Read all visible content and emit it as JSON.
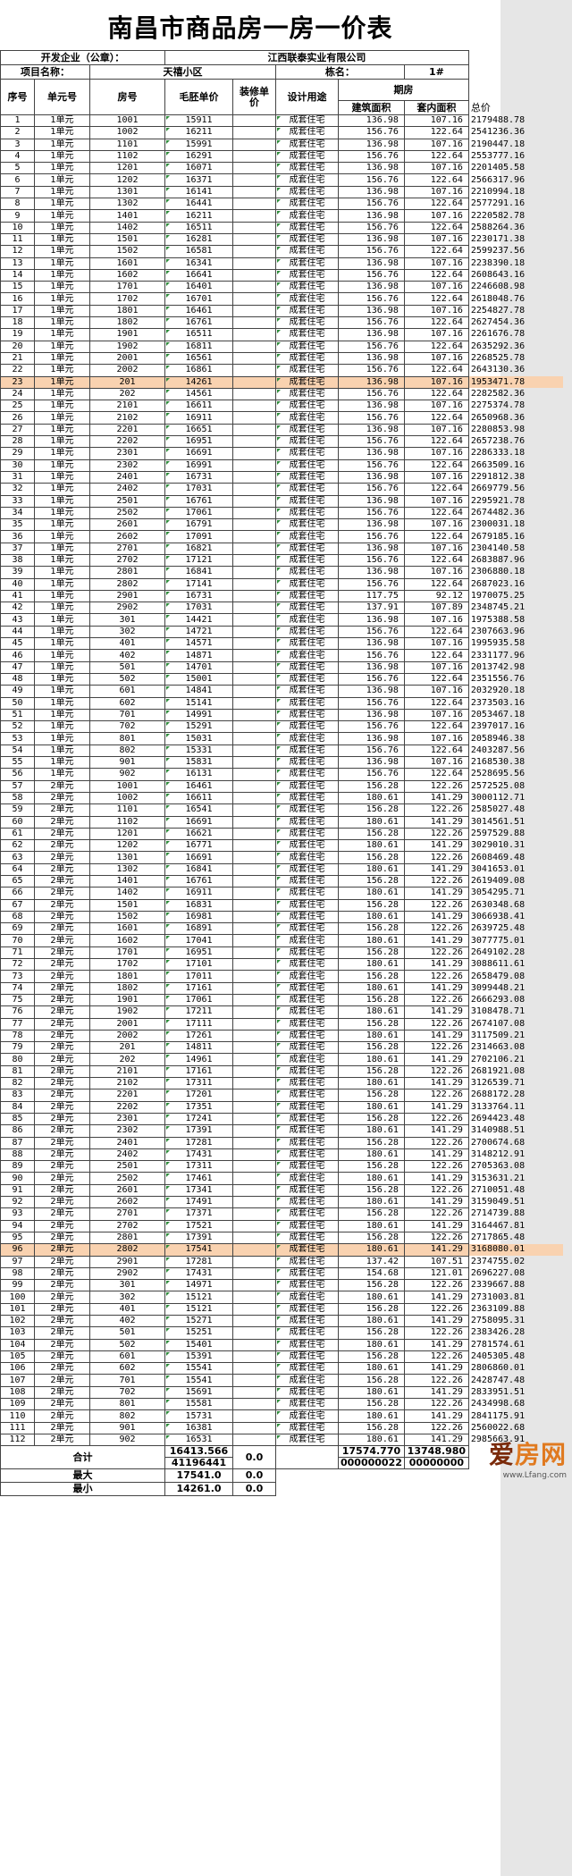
{
  "title": "南昌市商品房一房一价表",
  "developer_label": "开发企业（公章）：",
  "developer_name": "江西联泰实业有限公司",
  "project_label": "项目名称：",
  "project_name": "天禧小区",
  "building_label": "栋名：",
  "building_name": "1#",
  "headers": {
    "seq": "序号",
    "unit": "单元号",
    "room": "房号",
    "price": "毛胚单价",
    "deco": "装修单价",
    "use": "设计用途",
    "group": "期房",
    "build_area": "建筑面积",
    "inner_area": "套内面积",
    "total": "总价"
  },
  "rows": [
    [
      "1",
      "1单元",
      "1001",
      "15911",
      "",
      "成套住宅",
      "136.98",
      "107.16",
      "2179488.78"
    ],
    [
      "2",
      "1单元",
      "1002",
      "16211",
      "",
      "成套住宅",
      "156.76",
      "122.64",
      "2541236.36"
    ],
    [
      "3",
      "1单元",
      "1101",
      "15991",
      "",
      "成套住宅",
      "136.98",
      "107.16",
      "2190447.18"
    ],
    [
      "4",
      "1单元",
      "1102",
      "16291",
      "",
      "成套住宅",
      "156.76",
      "122.64",
      "2553777.16"
    ],
    [
      "5",
      "1单元",
      "1201",
      "16071",
      "",
      "成套住宅",
      "136.98",
      "107.16",
      "2201405.58"
    ],
    [
      "6",
      "1单元",
      "1202",
      "16371",
      "",
      "成套住宅",
      "156.76",
      "122.64",
      "2566317.96"
    ],
    [
      "7",
      "1单元",
      "1301",
      "16141",
      "",
      "成套住宅",
      "136.98",
      "107.16",
      "2210994.18"
    ],
    [
      "8",
      "1单元",
      "1302",
      "16441",
      "",
      "成套住宅",
      "156.76",
      "122.64",
      "2577291.16"
    ],
    [
      "9",
      "1单元",
      "1401",
      "16211",
      "",
      "成套住宅",
      "136.98",
      "107.16",
      "2220582.78"
    ],
    [
      "10",
      "1单元",
      "1402",
      "16511",
      "",
      "成套住宅",
      "156.76",
      "122.64",
      "2588264.36"
    ],
    [
      "11",
      "1单元",
      "1501",
      "16281",
      "",
      "成套住宅",
      "136.98",
      "107.16",
      "2230171.38"
    ],
    [
      "12",
      "1单元",
      "1502",
      "16581",
      "",
      "成套住宅",
      "156.76",
      "122.64",
      "2599237.56"
    ],
    [
      "13",
      "1单元",
      "1601",
      "16341",
      "",
      "成套住宅",
      "136.98",
      "107.16",
      "2238390.18"
    ],
    [
      "14",
      "1单元",
      "1602",
      "16641",
      "",
      "成套住宅",
      "156.76",
      "122.64",
      "2608643.16"
    ],
    [
      "15",
      "1单元",
      "1701",
      "16401",
      "",
      "成套住宅",
      "136.98",
      "107.16",
      "2246608.98"
    ],
    [
      "16",
      "1单元",
      "1702",
      "16701",
      "",
      "成套住宅",
      "156.76",
      "122.64",
      "2618048.76"
    ],
    [
      "17",
      "1单元",
      "1801",
      "16461",
      "",
      "成套住宅",
      "136.98",
      "107.16",
      "2254827.78"
    ],
    [
      "18",
      "1单元",
      "1802",
      "16761",
      "",
      "成套住宅",
      "156.76",
      "122.64",
      "2627454.36"
    ],
    [
      "19",
      "1单元",
      "1901",
      "16511",
      "",
      "成套住宅",
      "136.98",
      "107.16",
      "2261676.78"
    ],
    [
      "20",
      "1单元",
      "1902",
      "16811",
      "",
      "成套住宅",
      "156.76",
      "122.64",
      "2635292.36"
    ],
    [
      "21",
      "1单元",
      "2001",
      "16561",
      "",
      "成套住宅",
      "136.98",
      "107.16",
      "2268525.78"
    ],
    [
      "22",
      "1单元",
      "2002",
      "16861",
      "",
      "成套住宅",
      "156.76",
      "122.64",
      "2643130.36"
    ],
    [
      "23",
      "1单元",
      "201",
      "14261",
      "",
      "成套住宅",
      "136.98",
      "107.16",
      "1953471.78"
    ],
    [
      "24",
      "1单元",
      "202",
      "14561",
      "",
      "成套住宅",
      "156.76",
      "122.64",
      "2282582.36"
    ],
    [
      "25",
      "1单元",
      "2101",
      "16611",
      "",
      "成套住宅",
      "136.98",
      "107.16",
      "2275374.78"
    ],
    [
      "26",
      "1单元",
      "2102",
      "16911",
      "",
      "成套住宅",
      "156.76",
      "122.64",
      "2650968.36"
    ],
    [
      "27",
      "1单元",
      "2201",
      "16651",
      "",
      "成套住宅",
      "136.98",
      "107.16",
      "2280853.98"
    ],
    [
      "28",
      "1单元",
      "2202",
      "16951",
      "",
      "成套住宅",
      "156.76",
      "122.64",
      "2657238.76"
    ],
    [
      "29",
      "1单元",
      "2301",
      "16691",
      "",
      "成套住宅",
      "136.98",
      "107.16",
      "2286333.18"
    ],
    [
      "30",
      "1单元",
      "2302",
      "16991",
      "",
      "成套住宅",
      "156.76",
      "122.64",
      "2663509.16"
    ],
    [
      "31",
      "1单元",
      "2401",
      "16731",
      "",
      "成套住宅",
      "136.98",
      "107.16",
      "2291812.38"
    ],
    [
      "32",
      "1单元",
      "2402",
      "17031",
      "",
      "成套住宅",
      "156.76",
      "122.64",
      "2669779.56"
    ],
    [
      "33",
      "1单元",
      "2501",
      "16761",
      "",
      "成套住宅",
      "136.98",
      "107.16",
      "2295921.78"
    ],
    [
      "34",
      "1单元",
      "2502",
      "17061",
      "",
      "成套住宅",
      "156.76",
      "122.64",
      "2674482.36"
    ],
    [
      "35",
      "1单元",
      "2601",
      "16791",
      "",
      "成套住宅",
      "136.98",
      "107.16",
      "2300031.18"
    ],
    [
      "36",
      "1单元",
      "2602",
      "17091",
      "",
      "成套住宅",
      "156.76",
      "122.64",
      "2679185.16"
    ],
    [
      "37",
      "1单元",
      "2701",
      "16821",
      "",
      "成套住宅",
      "136.98",
      "107.16",
      "2304140.58"
    ],
    [
      "38",
      "1单元",
      "2702",
      "17121",
      "",
      "成套住宅",
      "156.76",
      "122.64",
      "2683887.96"
    ],
    [
      "39",
      "1单元",
      "2801",
      "16841",
      "",
      "成套住宅",
      "136.98",
      "107.16",
      "2306880.18"
    ],
    [
      "40",
      "1单元",
      "2802",
      "17141",
      "",
      "成套住宅",
      "156.76",
      "122.64",
      "2687023.16"
    ],
    [
      "41",
      "1单元",
      "2901",
      "16731",
      "",
      "成套住宅",
      "117.75",
      "92.12",
      "1970075.25"
    ],
    [
      "42",
      "1单元",
      "2902",
      "17031",
      "",
      "成套住宅",
      "137.91",
      "107.89",
      "2348745.21"
    ],
    [
      "43",
      "1单元",
      "301",
      "14421",
      "",
      "成套住宅",
      "136.98",
      "107.16",
      "1975388.58"
    ],
    [
      "44",
      "1单元",
      "302",
      "14721",
      "",
      "成套住宅",
      "156.76",
      "122.64",
      "2307663.96"
    ],
    [
      "45",
      "1单元",
      "401",
      "14571",
      "",
      "成套住宅",
      "136.98",
      "107.16",
      "1995935.58"
    ],
    [
      "46",
      "1单元",
      "402",
      "14871",
      "",
      "成套住宅",
      "156.76",
      "122.64",
      "2331177.96"
    ],
    [
      "47",
      "1单元",
      "501",
      "14701",
      "",
      "成套住宅",
      "136.98",
      "107.16",
      "2013742.98"
    ],
    [
      "48",
      "1单元",
      "502",
      "15001",
      "",
      "成套住宅",
      "156.76",
      "122.64",
      "2351556.76"
    ],
    [
      "49",
      "1单元",
      "601",
      "14841",
      "",
      "成套住宅",
      "136.98",
      "107.16",
      "2032920.18"
    ],
    [
      "50",
      "1单元",
      "602",
      "15141",
      "",
      "成套住宅",
      "156.76",
      "122.64",
      "2373503.16"
    ],
    [
      "51",
      "1单元",
      "701",
      "14991",
      "",
      "成套住宅",
      "136.98",
      "107.16",
      "2053467.18"
    ],
    [
      "52",
      "1单元",
      "702",
      "15291",
      "",
      "成套住宅",
      "156.76",
      "122.64",
      "2397017.16"
    ],
    [
      "53",
      "1单元",
      "801",
      "15031",
      "",
      "成套住宅",
      "136.98",
      "107.16",
      "2058946.38"
    ],
    [
      "54",
      "1单元",
      "802",
      "15331",
      "",
      "成套住宅",
      "156.76",
      "122.64",
      "2403287.56"
    ],
    [
      "55",
      "1单元",
      "901",
      "15831",
      "",
      "成套住宅",
      "136.98",
      "107.16",
      "2168530.38"
    ],
    [
      "56",
      "1单元",
      "902",
      "16131",
      "",
      "成套住宅",
      "156.76",
      "122.64",
      "2528695.56"
    ],
    [
      "57",
      "2单元",
      "1001",
      "16461",
      "",
      "成套住宅",
      "156.28",
      "122.26",
      "2572525.08"
    ],
    [
      "58",
      "2单元",
      "1002",
      "16611",
      "",
      "成套住宅",
      "180.61",
      "141.29",
      "3000112.71"
    ],
    [
      "59",
      "2单元",
      "1101",
      "16541",
      "",
      "成套住宅",
      "156.28",
      "122.26",
      "2585027.48"
    ],
    [
      "60",
      "2单元",
      "1102",
      "16691",
      "",
      "成套住宅",
      "180.61",
      "141.29",
      "3014561.51"
    ],
    [
      "61",
      "2单元",
      "1201",
      "16621",
      "",
      "成套住宅",
      "156.28",
      "122.26",
      "2597529.88"
    ],
    [
      "62",
      "2单元",
      "1202",
      "16771",
      "",
      "成套住宅",
      "180.61",
      "141.29",
      "3029010.31"
    ],
    [
      "63",
      "2单元",
      "1301",
      "16691",
      "",
      "成套住宅",
      "156.28",
      "122.26",
      "2608469.48"
    ],
    [
      "64",
      "2单元",
      "1302",
      "16841",
      "",
      "成套住宅",
      "180.61",
      "141.29",
      "3041653.01"
    ],
    [
      "65",
      "2单元",
      "1401",
      "16761",
      "",
      "成套住宅",
      "156.28",
      "122.26",
      "2619409.08"
    ],
    [
      "66",
      "2单元",
      "1402",
      "16911",
      "",
      "成套住宅",
      "180.61",
      "141.29",
      "3054295.71"
    ],
    [
      "67",
      "2单元",
      "1501",
      "16831",
      "",
      "成套住宅",
      "156.28",
      "122.26",
      "2630348.68"
    ],
    [
      "68",
      "2单元",
      "1502",
      "16981",
      "",
      "成套住宅",
      "180.61",
      "141.29",
      "3066938.41"
    ],
    [
      "69",
      "2单元",
      "1601",
      "16891",
      "",
      "成套住宅",
      "156.28",
      "122.26",
      "2639725.48"
    ],
    [
      "70",
      "2单元",
      "1602",
      "17041",
      "",
      "成套住宅",
      "180.61",
      "141.29",
      "3077775.01"
    ],
    [
      "71",
      "2单元",
      "1701",
      "16951",
      "",
      "成套住宅",
      "156.28",
      "122.26",
      "2649102.28"
    ],
    [
      "72",
      "2单元",
      "1702",
      "17101",
      "",
      "成套住宅",
      "180.61",
      "141.29",
      "3088611.61"
    ],
    [
      "73",
      "2单元",
      "1801",
      "17011",
      "",
      "成套住宅",
      "156.28",
      "122.26",
      "2658479.08"
    ],
    [
      "74",
      "2单元",
      "1802",
      "17161",
      "",
      "成套住宅",
      "180.61",
      "141.29",
      "3099448.21"
    ],
    [
      "75",
      "2单元",
      "1901",
      "17061",
      "",
      "成套住宅",
      "156.28",
      "122.26",
      "2666293.08"
    ],
    [
      "76",
      "2单元",
      "1902",
      "17211",
      "",
      "成套住宅",
      "180.61",
      "141.29",
      "3108478.71"
    ],
    [
      "77",
      "2单元",
      "2001",
      "17111",
      "",
      "成套住宅",
      "156.28",
      "122.26",
      "2674107.08"
    ],
    [
      "78",
      "2单元",
      "2002",
      "17261",
      "",
      "成套住宅",
      "180.61",
      "141.29",
      "3117509.21"
    ],
    [
      "79",
      "2单元",
      "201",
      "14811",
      "",
      "成套住宅",
      "156.28",
      "122.26",
      "2314663.08"
    ],
    [
      "80",
      "2单元",
      "202",
      "14961",
      "",
      "成套住宅",
      "180.61",
      "141.29",
      "2702106.21"
    ],
    [
      "81",
      "2单元",
      "2101",
      "17161",
      "",
      "成套住宅",
      "156.28",
      "122.26",
      "2681921.08"
    ],
    [
      "82",
      "2单元",
      "2102",
      "17311",
      "",
      "成套住宅",
      "180.61",
      "141.29",
      "3126539.71"
    ],
    [
      "83",
      "2单元",
      "2201",
      "17201",
      "",
      "成套住宅",
      "156.28",
      "122.26",
      "2688172.28"
    ],
    [
      "84",
      "2单元",
      "2202",
      "17351",
      "",
      "成套住宅",
      "180.61",
      "141.29",
      "3133764.11"
    ],
    [
      "85",
      "2单元",
      "2301",
      "17241",
      "",
      "成套住宅",
      "156.28",
      "122.26",
      "2694423.48"
    ],
    [
      "86",
      "2单元",
      "2302",
      "17391",
      "",
      "成套住宅",
      "180.61",
      "141.29",
      "3140988.51"
    ],
    [
      "87",
      "2单元",
      "2401",
      "17281",
      "",
      "成套住宅",
      "156.28",
      "122.26",
      "2700674.68"
    ],
    [
      "88",
      "2单元",
      "2402",
      "17431",
      "",
      "成套住宅",
      "180.61",
      "141.29",
      "3148212.91"
    ],
    [
      "89",
      "2单元",
      "2501",
      "17311",
      "",
      "成套住宅",
      "156.28",
      "122.26",
      "2705363.08"
    ],
    [
      "90",
      "2单元",
      "2502",
      "17461",
      "",
      "成套住宅",
      "180.61",
      "141.29",
      "3153631.21"
    ],
    [
      "91",
      "2单元",
      "2601",
      "17341",
      "",
      "成套住宅",
      "156.28",
      "122.26",
      "2710051.48"
    ],
    [
      "92",
      "2单元",
      "2602",
      "17491",
      "",
      "成套住宅",
      "180.61",
      "141.29",
      "3159049.51"
    ],
    [
      "93",
      "2单元",
      "2701",
      "17371",
      "",
      "成套住宅",
      "156.28",
      "122.26",
      "2714739.88"
    ],
    [
      "94",
      "2单元",
      "2702",
      "17521",
      "",
      "成套住宅",
      "180.61",
      "141.29",
      "3164467.81"
    ],
    [
      "95",
      "2单元",
      "2801",
      "17391",
      "",
      "成套住宅",
      "156.28",
      "122.26",
      "2717865.48"
    ],
    [
      "96",
      "2单元",
      "2802",
      "17541",
      "",
      "成套住宅",
      "180.61",
      "141.29",
      "3168080.01"
    ],
    [
      "97",
      "2单元",
      "2901",
      "17281",
      "",
      "成套住宅",
      "137.42",
      "107.51",
      "2374755.02"
    ],
    [
      "98",
      "2单元",
      "2902",
      "17431",
      "",
      "成套住宅",
      "154.68",
      "121.01",
      "2696227.08"
    ],
    [
      "99",
      "2单元",
      "301",
      "14971",
      "",
      "成套住宅",
      "156.28",
      "122.26",
      "2339667.88"
    ],
    [
      "100",
      "2单元",
      "302",
      "15121",
      "",
      "成套住宅",
      "180.61",
      "141.29",
      "2731003.81"
    ],
    [
      "101",
      "2单元",
      "401",
      "15121",
      "",
      "成套住宅",
      "156.28",
      "122.26",
      "2363109.88"
    ],
    [
      "102",
      "2单元",
      "402",
      "15271",
      "",
      "成套住宅",
      "180.61",
      "141.29",
      "2758095.31"
    ],
    [
      "103",
      "2单元",
      "501",
      "15251",
      "",
      "成套住宅",
      "156.28",
      "122.26",
      "2383426.28"
    ],
    [
      "104",
      "2单元",
      "502",
      "15401",
      "",
      "成套住宅",
      "180.61",
      "141.29",
      "2781574.61"
    ],
    [
      "105",
      "2单元",
      "601",
      "15391",
      "",
      "成套住宅",
      "156.28",
      "122.26",
      "2405305.48"
    ],
    [
      "106",
      "2单元",
      "602",
      "15541",
      "",
      "成套住宅",
      "180.61",
      "141.29",
      "2806860.01"
    ],
    [
      "107",
      "2单元",
      "701",
      "15541",
      "",
      "成套住宅",
      "156.28",
      "122.26",
      "2428747.48"
    ],
    [
      "108",
      "2单元",
      "702",
      "15691",
      "",
      "成套住宅",
      "180.61",
      "141.29",
      "2833951.51"
    ],
    [
      "109",
      "2单元",
      "801",
      "15581",
      "",
      "成套住宅",
      "156.28",
      "122.26",
      "2434998.68"
    ],
    [
      "110",
      "2单元",
      "802",
      "15731",
      "",
      "成套住宅",
      "180.61",
      "141.29",
      "2841175.91"
    ],
    [
      "111",
      "2单元",
      "901",
      "16381",
      "",
      "成套住宅",
      "156.28",
      "122.26",
      "2560022.68"
    ],
    [
      "112",
      "2单元",
      "902",
      "16531",
      "",
      "成套住宅",
      "180.61",
      "141.29",
      "2985663.91"
    ]
  ],
  "highlight_rows": [
    "23",
    "96"
  ],
  "footer": {
    "sum_label": "合计",
    "sum_price_line1": "16413.566",
    "sum_price_line2": "41196441",
    "sum_deco": "0.0",
    "sum_area_line1": "17574.770",
    "sum_area_line2": "000000022",
    "sum_inner_line1": "13748.980",
    "sum_inner_line2": "00000000",
    "max_label": "最大",
    "max_price": "17541.0",
    "max_deco": "0.0",
    "min_label": "最小",
    "min_price": "14261.0",
    "min_deco": "0.0"
  },
  "watermark": {
    "logo_a": "爱",
    "logo_b": "房网",
    "url": "www.Lfang.com"
  },
  "colors": {
    "highlight": "#f9d2b0",
    "side_strip": "#e6e6e6",
    "corner_mark": "#2e8b3b",
    "watermark": "#e07a20"
  }
}
